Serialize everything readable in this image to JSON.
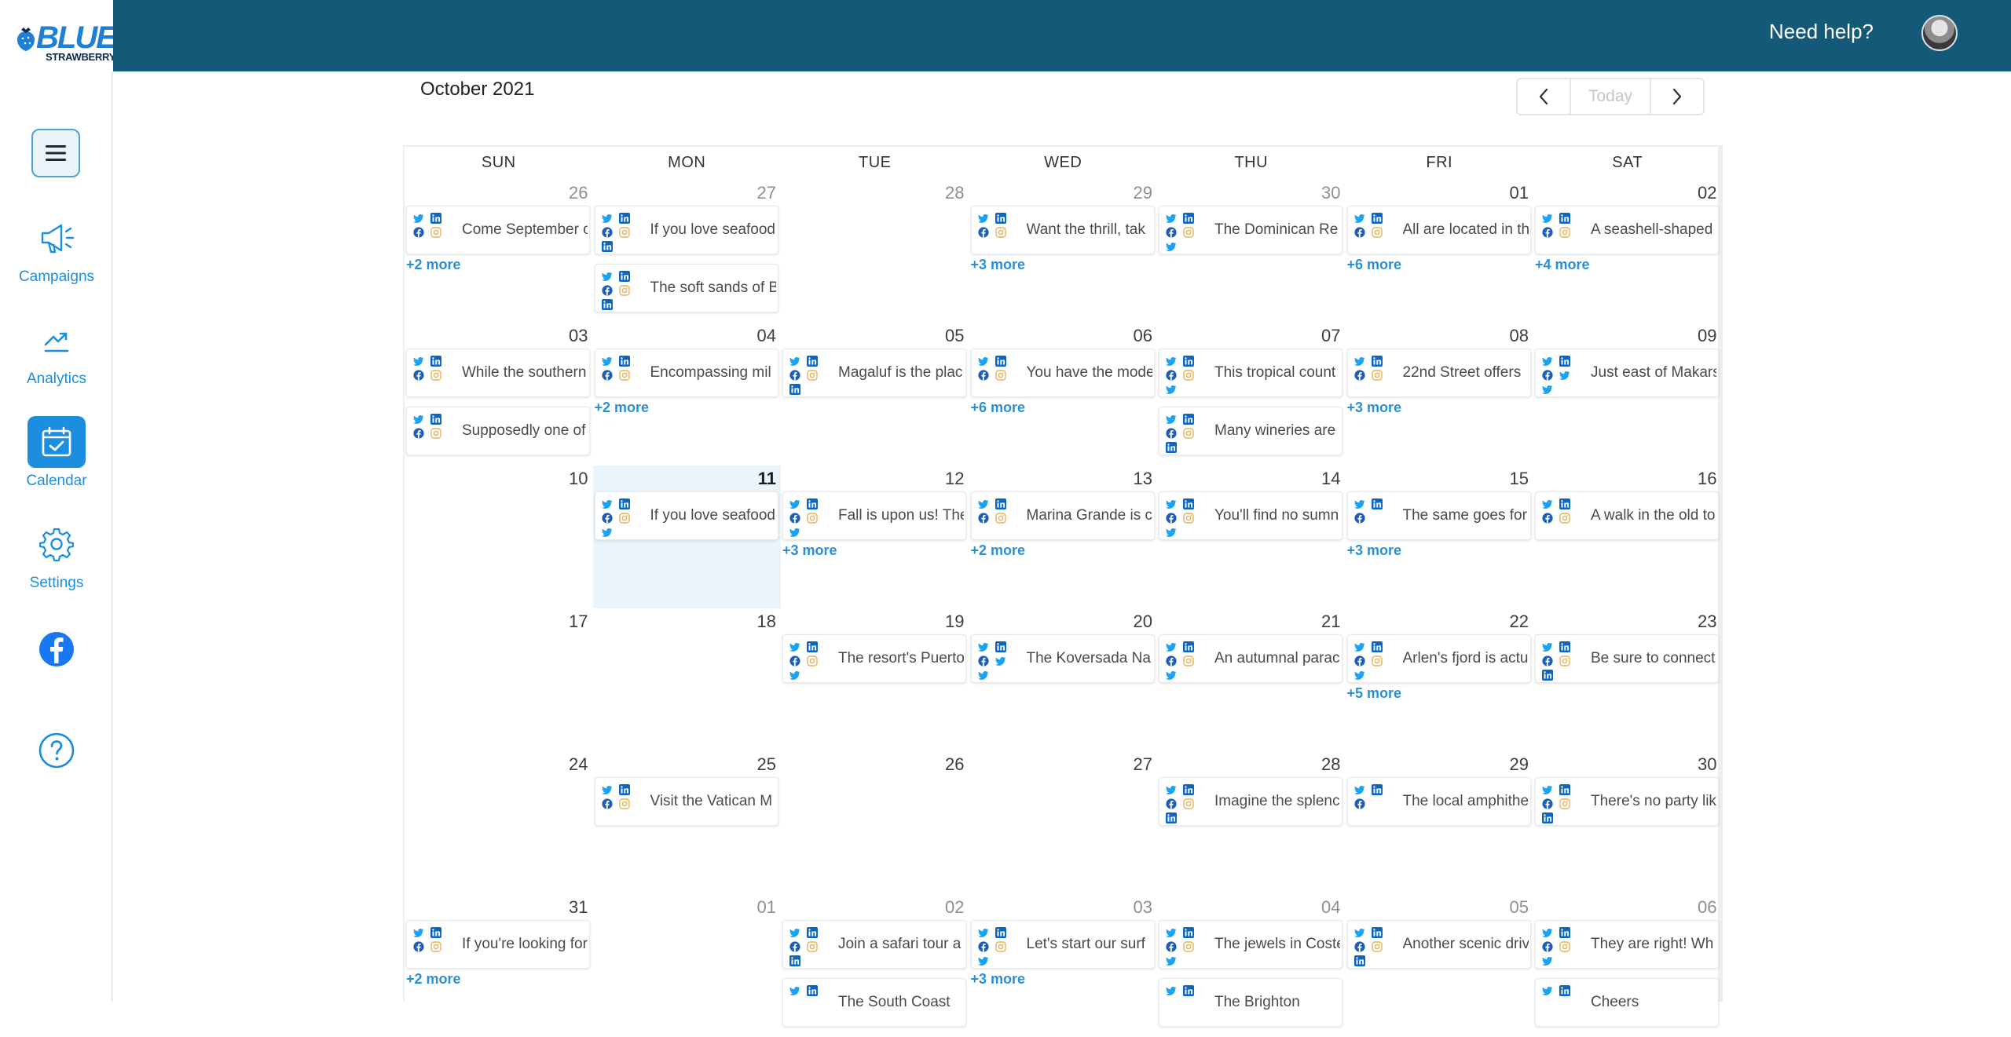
{
  "app": {
    "brand_top": "BLUE",
    "brand_bottom": "STRAWBERRY",
    "need_help": "Need help?"
  },
  "sidebar": {
    "items": [
      {
        "label": "Campaigns",
        "icon": "megaphone-icon"
      },
      {
        "label": "Analytics",
        "icon": "trend-up-icon"
      },
      {
        "label": "Calendar",
        "icon": "calendar-check-icon",
        "active": true
      },
      {
        "label": "Settings",
        "icon": "gear-icon"
      }
    ]
  },
  "calendar": {
    "month_label": "October 2021",
    "today_label": "Today",
    "weekdays": [
      "SUN",
      "MON",
      "TUE",
      "WED",
      "THU",
      "FRI",
      "SAT"
    ],
    "weeks": [
      [
        {
          "day": "26",
          "muted": true,
          "posts": [
            {
              "text": "Come September o",
              "icons": [
                "tw",
                "li",
                "fb",
                "ig"
              ]
            }
          ],
          "more": "+2 more"
        },
        {
          "day": "27",
          "muted": true,
          "posts": [
            {
              "text": "If you love seafood",
              "icons": [
                "tw",
                "li",
                "fb",
                "ig",
                "li2"
              ]
            },
            {
              "text": "The soft sands of B",
              "icons": [
                "tw",
                "li",
                "fb",
                "ig",
                "li2"
              ]
            }
          ]
        },
        {
          "day": "28",
          "muted": true,
          "posts": []
        },
        {
          "day": "29",
          "muted": true,
          "posts": [
            {
              "text": "Want the thrill, tak",
              "icons": [
                "tw",
                "li",
                "fb",
                "ig"
              ]
            }
          ],
          "more": "+3 more"
        },
        {
          "day": "30",
          "muted": true,
          "posts": [
            {
              "text": "The Dominican Re",
              "icons": [
                "tw",
                "li",
                "fb",
                "ig",
                "tw2"
              ]
            }
          ]
        },
        {
          "day": "01",
          "muted": false,
          "posts": [
            {
              "text": "All are located in th",
              "icons": [
                "tw",
                "li",
                "fb",
                "ig"
              ]
            }
          ],
          "more": "+6 more"
        },
        {
          "day": "02",
          "muted": false,
          "posts": [
            {
              "text": "A seashell-shaped",
              "icons": [
                "tw",
                "li",
                "fb",
                "ig"
              ]
            }
          ],
          "more": "+4 more"
        }
      ],
      [
        {
          "day": "03",
          "posts": [
            {
              "text": "While the southern",
              "icons": [
                "tw",
                "li",
                "fb",
                "ig"
              ]
            },
            {
              "text": "Supposedly one of",
              "icons": [
                "tw",
                "li",
                "fb",
                "ig"
              ]
            }
          ]
        },
        {
          "day": "04",
          "posts": [
            {
              "text": "Encompassing mil",
              "icons": [
                "tw",
                "li",
                "fb",
                "ig"
              ]
            }
          ],
          "more": "+2 more"
        },
        {
          "day": "05",
          "posts": [
            {
              "text": "Magaluf is the plac",
              "icons": [
                "tw",
                "li",
                "fb",
                "ig",
                "li2"
              ]
            }
          ]
        },
        {
          "day": "06",
          "posts": [
            {
              "text": "You have the mode",
              "icons": [
                "tw",
                "li",
                "fb",
                "ig"
              ]
            }
          ],
          "more": "+6 more"
        },
        {
          "day": "07",
          "posts": [
            {
              "text": "This tropical count",
              "icons": [
                "tw",
                "li",
                "fb",
                "ig",
                "tw2"
              ]
            },
            {
              "text": "Many wineries are",
              "icons": [
                "tw",
                "li",
                "fb",
                "ig",
                "li2"
              ]
            }
          ]
        },
        {
          "day": "08",
          "posts": [
            {
              "text": "22nd Street offers",
              "icons": [
                "tw",
                "li",
                "fb",
                "ig"
              ]
            }
          ],
          "more": "+3 more"
        },
        {
          "day": "09",
          "posts": [
            {
              "text": "Just east of Makars",
              "icons": [
                "tw",
                "li",
                "fb",
                "tw3",
                "tw2"
              ]
            }
          ]
        }
      ],
      [
        {
          "day": "10",
          "posts": []
        },
        {
          "day": "11",
          "today": true,
          "posts": [
            {
              "text": "If you love seafood",
              "icons": [
                "tw",
                "li",
                "fb",
                "ig",
                "tw2"
              ]
            }
          ]
        },
        {
          "day": "12",
          "posts": [
            {
              "text": "Fall is upon us! The",
              "icons": [
                "tw",
                "li",
                "fb",
                "ig",
                "tw2"
              ]
            }
          ],
          "more": "+3 more"
        },
        {
          "day": "13",
          "posts": [
            {
              "text": "Marina Grande is c",
              "icons": [
                "tw",
                "li",
                "fb",
                "ig"
              ]
            }
          ],
          "more": "+2 more"
        },
        {
          "day": "14",
          "posts": [
            {
              "text": "You'll find no sumn",
              "icons": [
                "tw",
                "li",
                "fb",
                "ig",
                "tw2"
              ]
            }
          ]
        },
        {
          "day": "15",
          "posts": [
            {
              "text": "The same goes for",
              "icons": [
                "tw",
                "li",
                "fb"
              ]
            }
          ],
          "more": "+3 more"
        },
        {
          "day": "16",
          "posts": [
            {
              "text": "A walk in the old to",
              "icons": [
                "tw",
                "li",
                "fb",
                "ig"
              ]
            }
          ]
        }
      ],
      [
        {
          "day": "17",
          "posts": []
        },
        {
          "day": "18",
          "posts": []
        },
        {
          "day": "19",
          "posts": [
            {
              "text": "The resort's Puerto",
              "icons": [
                "tw",
                "li",
                "fb",
                "ig",
                "tw2"
              ]
            }
          ]
        },
        {
          "day": "20",
          "posts": [
            {
              "text": "The Koversada Na",
              "icons": [
                "tw",
                "li",
                "fb",
                "tw3",
                "tw2"
              ]
            }
          ]
        },
        {
          "day": "21",
          "posts": [
            {
              "text": "An autumnal parac",
              "icons": [
                "tw",
                "li",
                "fb",
                "ig",
                "tw2"
              ]
            }
          ]
        },
        {
          "day": "22",
          "posts": [
            {
              "text": "Arlen's fjord is actu",
              "icons": [
                "tw",
                "li",
                "fb",
                "ig",
                "tw2"
              ]
            }
          ],
          "more": "+5 more"
        },
        {
          "day": "23",
          "posts": [
            {
              "text": "Be sure to connect",
              "icons": [
                "tw",
                "li",
                "fb",
                "ig",
                "li2"
              ]
            }
          ]
        }
      ],
      [
        {
          "day": "24",
          "posts": []
        },
        {
          "day": "25",
          "posts": [
            {
              "text": "Visit the Vatican M",
              "icons": [
                "tw",
                "li",
                "fb",
                "ig"
              ]
            }
          ]
        },
        {
          "day": "26",
          "posts": []
        },
        {
          "day": "27",
          "posts": []
        },
        {
          "day": "28",
          "posts": [
            {
              "text": "Imagine the splenc",
              "icons": [
                "tw",
                "li",
                "fb",
                "ig",
                "li2"
              ]
            }
          ]
        },
        {
          "day": "29",
          "posts": [
            {
              "text": "The local amphithe",
              "icons": [
                "tw",
                "li",
                "fb"
              ]
            }
          ]
        },
        {
          "day": "30",
          "posts": [
            {
              "text": "There's no party lik",
              "icons": [
                "tw",
                "li",
                "fb",
                "ig",
                "li2"
              ]
            }
          ]
        }
      ],
      [
        {
          "day": "31",
          "posts": [
            {
              "text": "If you're looking for",
              "icons": [
                "tw",
                "li",
                "fb",
                "ig"
              ]
            }
          ],
          "more": "+2 more"
        },
        {
          "day": "01",
          "muted": true,
          "posts": []
        },
        {
          "day": "02",
          "muted": true,
          "posts": [
            {
              "text": "Join a safari tour a",
              "icons": [
                "tw",
                "li",
                "fb",
                "ig",
                "li2"
              ]
            },
            {
              "text": "The South Coast",
              "icons": [
                "tw",
                "li"
              ]
            }
          ]
        },
        {
          "day": "03",
          "muted": true,
          "posts": [
            {
              "text": "Let's start our surf",
              "icons": [
                "tw",
                "li",
                "fb",
                "ig",
                "tw2"
              ]
            }
          ],
          "more": "+3 more"
        },
        {
          "day": "04",
          "muted": true,
          "posts": [
            {
              "text": "The jewels in Coste",
              "icons": [
                "tw",
                "li",
                "fb",
                "ig",
                "tw2"
              ]
            },
            {
              "text": "The Brighton",
              "icons": [
                "tw",
                "li"
              ]
            }
          ]
        },
        {
          "day": "05",
          "muted": true,
          "posts": [
            {
              "text": "Another scenic driv",
              "icons": [
                "tw",
                "li",
                "fb",
                "ig",
                "li2"
              ]
            }
          ]
        },
        {
          "day": "06",
          "muted": true,
          "posts": [
            {
              "text": "They are right! Wh",
              "icons": [
                "tw",
                "li",
                "fb",
                "ig",
                "tw2"
              ]
            },
            {
              "text": "Cheers",
              "icons": [
                "tw",
                "li"
              ]
            }
          ]
        }
      ]
    ]
  },
  "colors": {
    "topbar": "#145a78",
    "accent": "#1c8ee0",
    "twitter": "#1da1f2",
    "linkedin": "#0a66c2",
    "facebook": "#1b5fb8",
    "instagram": "#e8b15a"
  }
}
